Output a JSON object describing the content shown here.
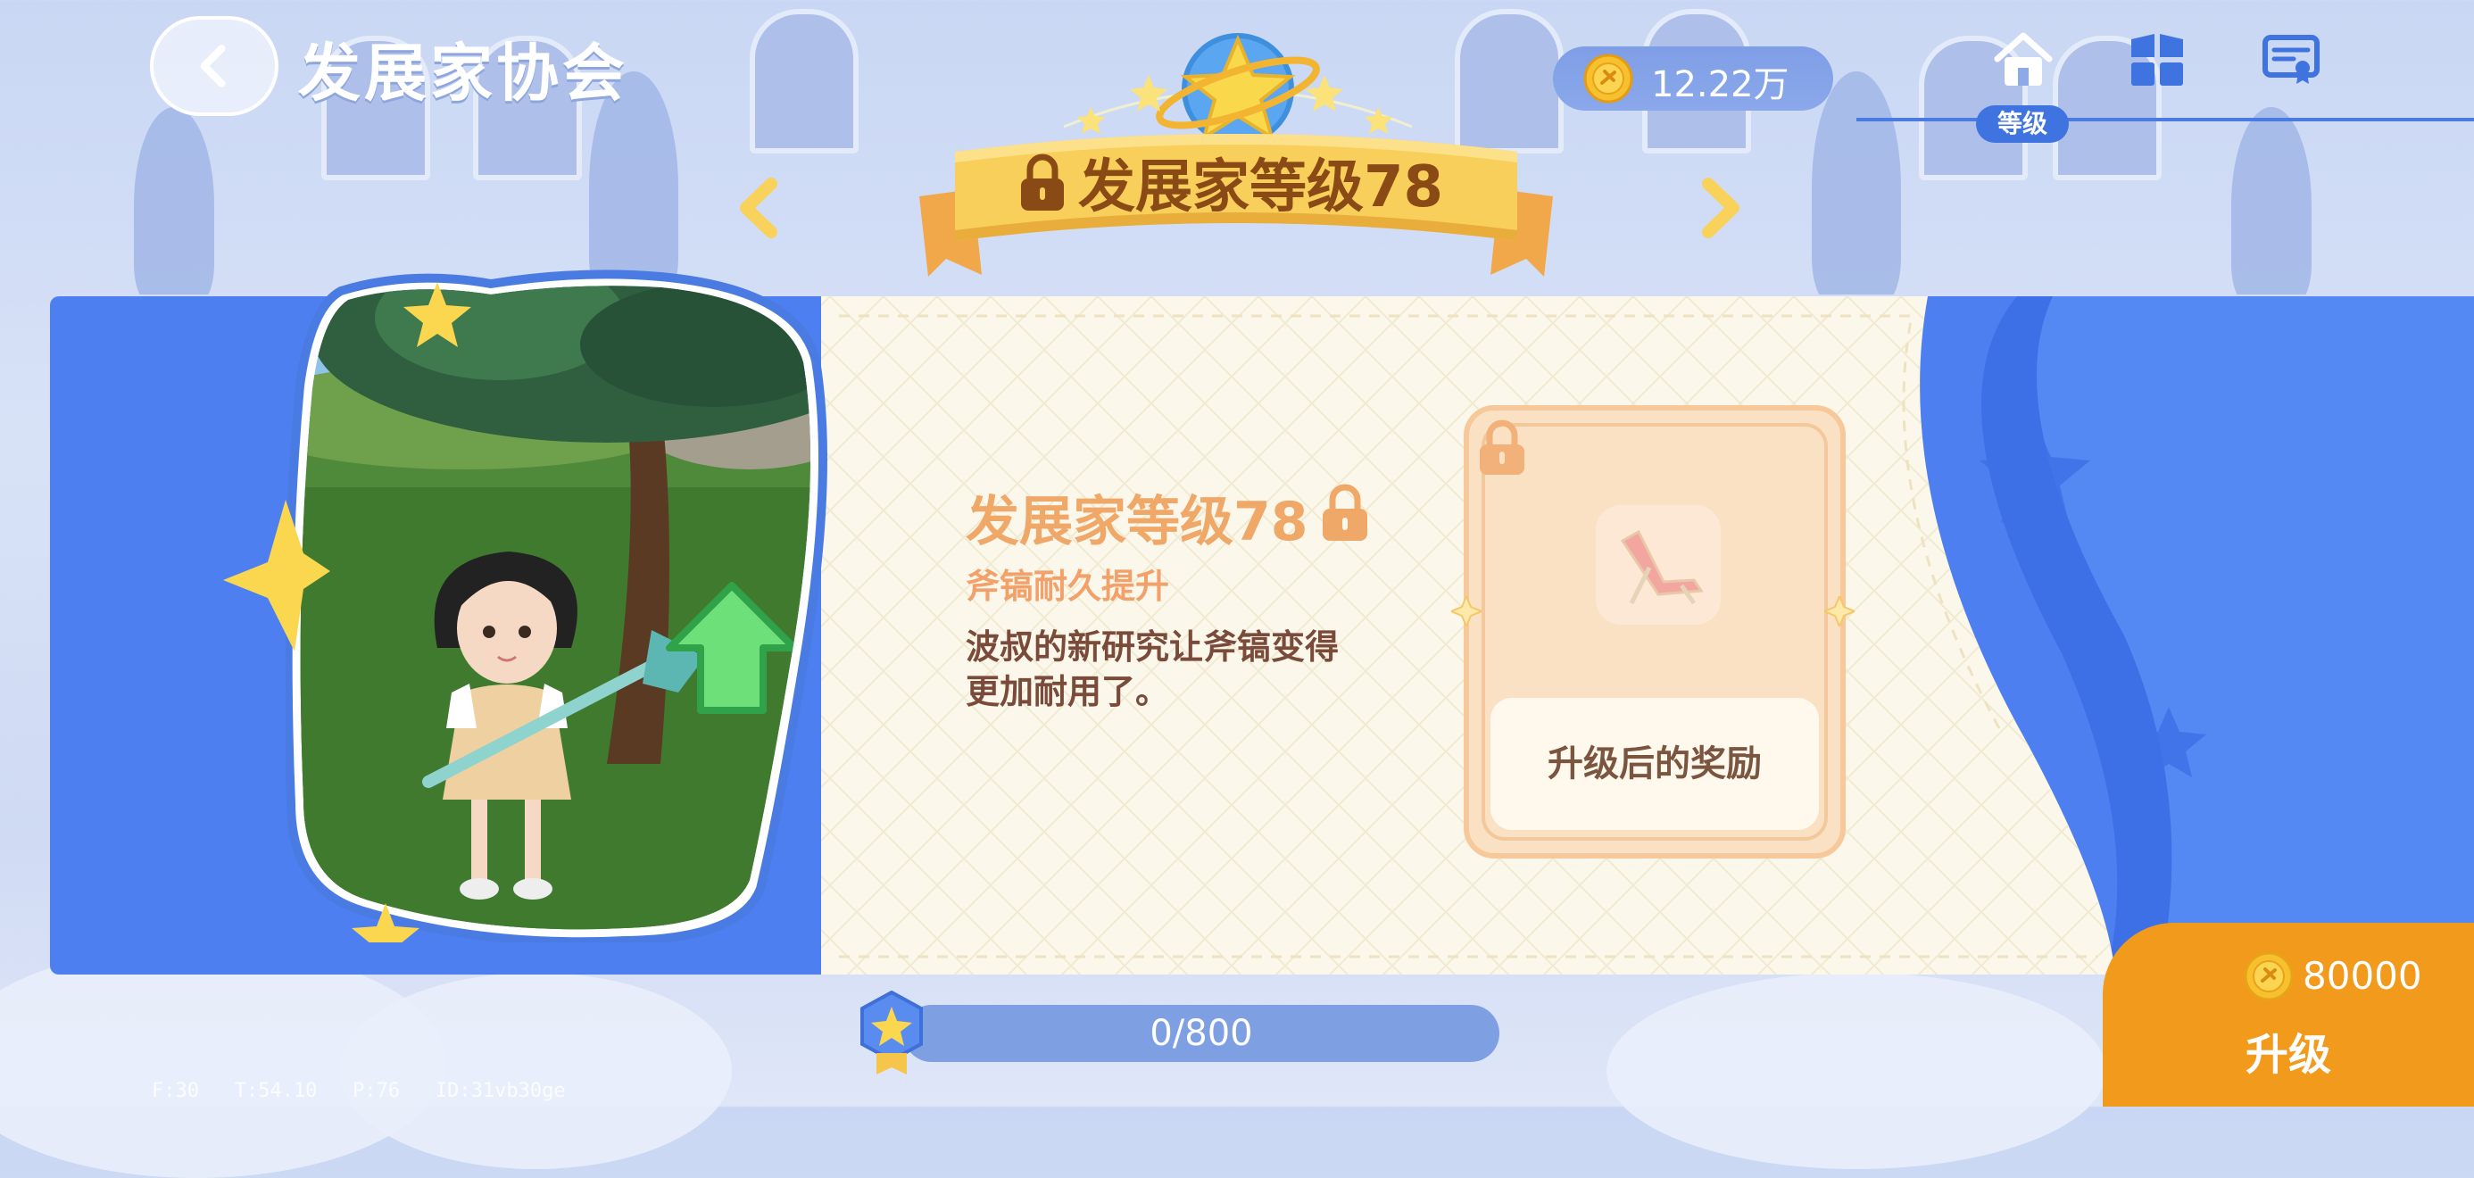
{
  "header": {
    "title": "发展家协会",
    "back_icon": "chevron-left-icon",
    "currency": {
      "icon": "coin-icon",
      "amount": "12.22万"
    },
    "nav": {
      "items": [
        {
          "icon": "home-icon",
          "label": "等级",
          "selected": true
        },
        {
          "icon": "grid-icon"
        },
        {
          "icon": "certificate-icon"
        }
      ]
    }
  },
  "level_banner": {
    "title": "发展家等级78",
    "locked": true,
    "prev_icon": "arrow-left-icon",
    "next_icon": "arrow-right-icon",
    "emblem_icon": "star-planet-emblem-icon"
  },
  "detail": {
    "title": "发展家等级78",
    "locked": true,
    "subtitle": "斧镐耐久提升",
    "description_line1": "波叔的新研究让斧镐变得",
    "description_line2": "更加耐用了。",
    "image_icon": "character-with-axe-image"
  },
  "reward": {
    "locked": true,
    "item_icon": "lounge-chair-icon",
    "button_label": "升级后的奖励"
  },
  "progress": {
    "text": "0/800",
    "current": 0,
    "max": 800
  },
  "upgrade": {
    "cost": "80000",
    "label": "升级",
    "coin_icon": "coin-icon"
  },
  "debug_overlay": "F:30   T:54.10   P:76   ID:31vb30ge",
  "colors": {
    "primary_blue": "#4e7ff0",
    "accent_orange": "#f29a1c",
    "ribbon_yellow": "#f7c94a",
    "cream": "#fbf7ea"
  }
}
